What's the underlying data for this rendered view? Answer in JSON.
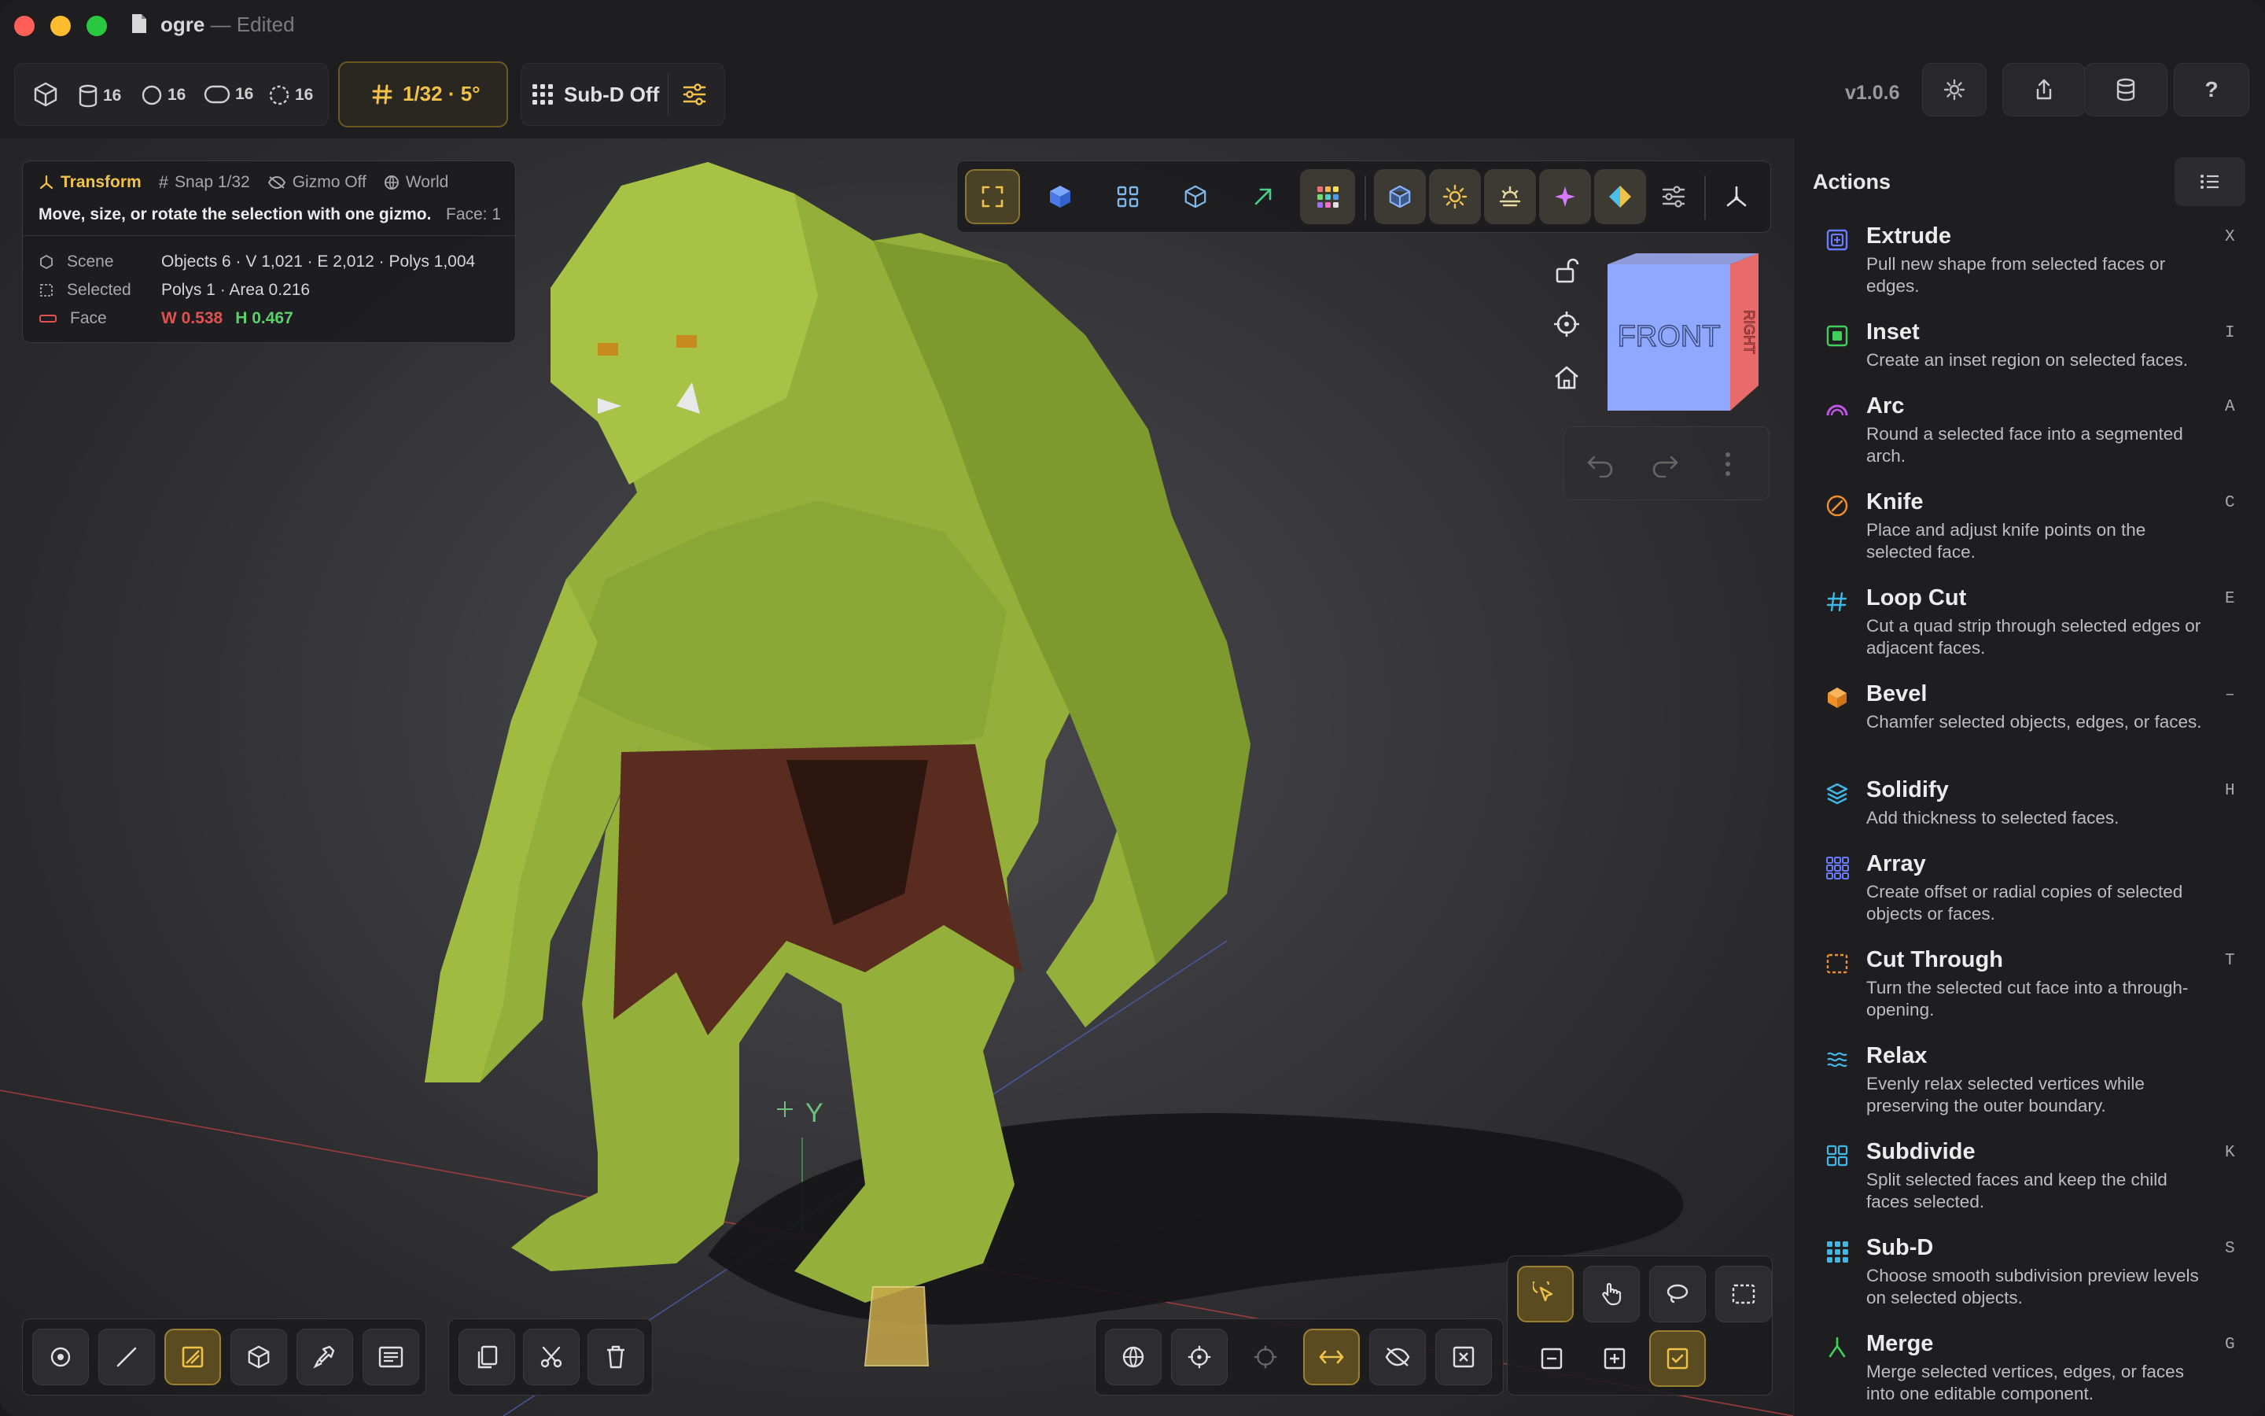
{
  "window": {
    "title": "ogre",
    "status": "— Edited"
  },
  "toolbar": {
    "stats": [
      {
        "icon": "cylinder-icon",
        "value": "16"
      },
      {
        "icon": "sphere-icon",
        "value": "16"
      },
      {
        "icon": "capsule-icon",
        "value": "16"
      },
      {
        "icon": "torus-icon",
        "value": "16"
      }
    ],
    "snap_label": "1/32 · 5°",
    "subd_label": "Sub-D  Off",
    "version": "v1.0.6"
  },
  "info_panel": {
    "mode": "Transform",
    "snap": "Snap 1/32",
    "gizmo": "Gizmo Off",
    "space": "World",
    "hint": "Move, size, or rotate the selection with one gizmo.",
    "face_label": "Face: 1",
    "scene_label": "Scene",
    "scene_value": "Objects 6 · V 1,021 · E 2,012 · Polys 1,004",
    "selected_label": "Selected",
    "selected_value": "Polys 1 · Area 0.216",
    "face_row_label": "Face",
    "face_w": "W 0.538",
    "face_h": "H 0.467",
    "colors": {
      "width": "#e05252",
      "height": "#5bd16a"
    }
  },
  "viewcube": {
    "front": "FRONT",
    "right": "RIGHT"
  },
  "axis_label": "Y",
  "sidebar": {
    "title": "Actions",
    "actions": [
      {
        "name": "Extrude",
        "desc": "Pull new shape from selected faces or edges.",
        "key": "X",
        "icon": "extrude-icon",
        "color": "#6b7cff"
      },
      {
        "name": "Inset",
        "desc": "Create an inset region on selected faces.",
        "key": "I",
        "icon": "inset-icon",
        "color": "#3fcf5a"
      },
      {
        "name": "Arc",
        "desc": "Round a selected face into a segmented arch.",
        "key": "A",
        "icon": "arc-icon",
        "color": "#c056e8"
      },
      {
        "name": "Knife",
        "desc": "Place and adjust knife points on the selected face.",
        "key": "C",
        "icon": "knife-icon",
        "color": "#f0902a"
      },
      {
        "name": "Loop Cut",
        "desc": "Cut a quad strip through selected edges or adjacent faces.",
        "key": "E",
        "icon": "loop-cut-icon",
        "color": "#3fb8e8"
      },
      {
        "name": "Bevel",
        "desc": "Chamfer selected objects, edges, or faces.",
        "key": "–",
        "icon": "bevel-icon",
        "color": "#f0902a"
      },
      {
        "name": "Solidify",
        "desc": "Add thickness to selected faces.",
        "key": "H",
        "icon": "solidify-icon",
        "color": "#3fb8e8"
      },
      {
        "name": "Array",
        "desc": "Create offset or radial copies of selected objects or faces.",
        "key": "",
        "icon": "array-icon",
        "color": "#6b7cff"
      },
      {
        "name": "Cut Through",
        "desc": "Turn the selected cut face into a through-opening.",
        "key": "T",
        "icon": "cut-through-icon",
        "color": "#f0902a"
      },
      {
        "name": "Relax",
        "desc": "Evenly relax selected vertices while preserving the outer boundary.",
        "key": "",
        "icon": "relax-icon",
        "color": "#3fb8e8"
      },
      {
        "name": "Subdivide",
        "desc": "Split selected faces and keep the child faces selected.",
        "key": "K",
        "icon": "subdivide-icon",
        "color": "#3fb8e8"
      },
      {
        "name": "Sub-D",
        "desc": "Choose smooth subdivision preview levels on selected objects.",
        "key": "S",
        "icon": "sub-d-icon",
        "color": "#3fb8e8"
      },
      {
        "name": "Merge",
        "desc": "Merge selected vertices, edges, or faces into one editable component.",
        "key": "G",
        "icon": "merge-icon",
        "color": "#3fcf5a"
      }
    ]
  }
}
